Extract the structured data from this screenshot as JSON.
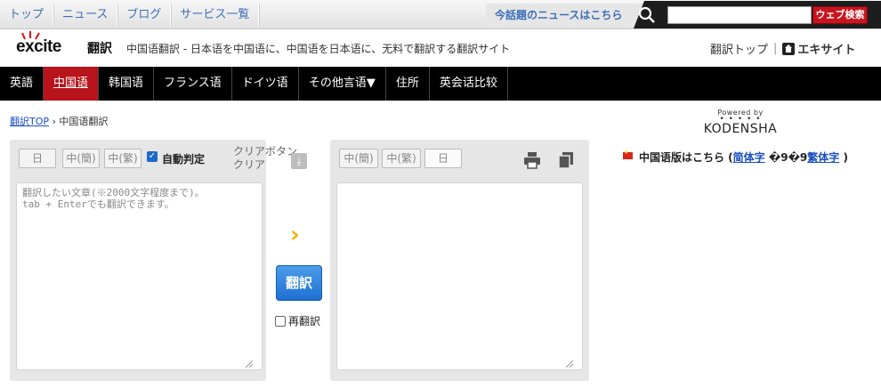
{
  "topnav": {
    "items": [
      "トップ",
      "ニュース",
      "ブログ",
      "サービス一覧"
    ],
    "hot_news": "今話題のニュースはこちら",
    "search_placeholder": "",
    "search_button": "ウェブ検索"
  },
  "header": {
    "logo": "excite",
    "logo_sub": "翻訳",
    "tagline": "中国语翻訳 - 日本语を中国语に、中国语を日本语に、无料で翻訳する翻訳サイト",
    "link_translate_top": "翻訳トップ",
    "link_excite": "エキサイト"
  },
  "langnav": {
    "items": [
      "英語",
      "中国语",
      "韩国语",
      "フランス语",
      "ドイツ语",
      "その他言语▼",
      "住所",
      "英会话比较"
    ],
    "active_index": 1
  },
  "breadcrumb": {
    "top_link": "翻訳TOP",
    "separator": "›",
    "current": "中国语翻訳"
  },
  "sponsor": {
    "powered": "Powered by",
    "name": "KODENSHA"
  },
  "left_panel": {
    "btn_ja": "日",
    "btn_zh_simplified": "中(簡)",
    "btn_zh_traditional": "中(繁)",
    "auto_detect_label": "自動判定",
    "auto_detect_checked": true,
    "placeholder": "翻訳したい文章(※2000文字程度まで)。\ntab + Enterでも翻訳できます。"
  },
  "middle": {
    "clear_alt": "クリアボタン",
    "clear_label": "クリア",
    "translate_button": "翻訳",
    "retranslate_label": "再翻訳"
  },
  "right_panel": {
    "btn_zh_simplified": "中(簡)",
    "btn_zh_traditional": "中(繁)",
    "btn_ja": "日"
  },
  "chinese_version": {
    "text_before": "中国语版はこちら (",
    "link_simplified": "简体字",
    "mid": " �9�9",
    "link_traditional": "繁体字",
    "text_after": " )"
  },
  "colors": {
    "nav_active": "#b8141c",
    "translate_button": "#1d6fd2",
    "link": "#1a4fc0"
  }
}
